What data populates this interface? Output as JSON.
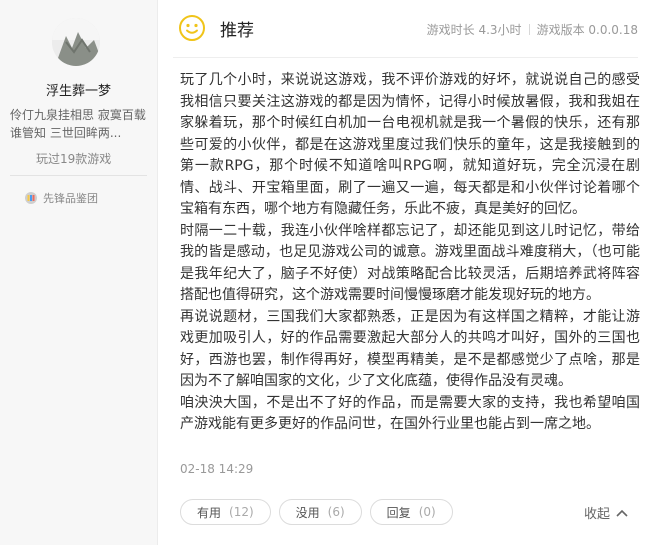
{
  "user": {
    "name": "浮生葬一梦",
    "bio": "伶仃九泉挂相思 寂寞百载谁管知 三世回眸两...",
    "played": "玩过19款游戏",
    "badge_label": "先锋品鉴团"
  },
  "review": {
    "verdict": "推荐",
    "playtime": "游戏时长 4.3小时",
    "version": "游戏版本 0.0.0.18",
    "paragraphs": [
      "玩了几个小时，来说说这游戏，我不评价游戏的好坏，就说说自己的感受我相信只要关注这游戏的都是因为情怀，记得小时候放暑假，我和我姐在家躲着玩，那个时候红白机加一台电视机就是我一个暑假的快乐，还有那些可爱的小伙伴，都是在这游戏里度过我们快乐的童年，这是我接触到的第一款RPG，那个时候不知道啥叫RPG啊，就知道好玩，完全沉浸在剧情、战斗、开宝箱里面，刷了一遍又一遍，每天都是和小伙伴讨论着哪个宝箱有东西，哪个地方有隐藏任务，乐此不疲，真是美好的回忆。",
      "时隔一二十载，我连小伙伴啥样都忘记了，却还能见到这儿时记忆，带给我的皆是感动，也足见游戏公司的诚意。游戏里面战斗难度稍大，（也可能是我年纪大了，脑子不好使）对战策略配合比较灵活，后期培养武将阵容搭配也值得研究，这个游戏需要时间慢慢琢磨才能发现好玩的地方。",
      "再说说题材，三国我们大家都熟悉，正是因为有这样国之精粹，才能让游戏更加吸引人，好的作品需要激起大部分人的共鸣才叫好，国外的三国也好，西游也罢，制作得再好，模型再精美，是不是都感觉少了点啥，那是因为不了解咱国家的文化，少了文化底蕴，使得作品没有灵魂。",
      "咱泱泱大国，不是出不了好的作品，而是需要大家的支持，我也希望咱国产游戏能有更多更好的作品问世，在国外行业里也能占到一席之地。"
    ],
    "date": "02-18 14:29"
  },
  "actions": {
    "useful_label": "有用",
    "useful_count": "(12)",
    "useless_label": "没用",
    "useless_count": "(6)",
    "reply_label": "回复",
    "reply_count": "(0)",
    "collapse_label": "收起"
  },
  "colors": {
    "accent_emoji": "#f0c419",
    "text": "#333333",
    "muted": "#999999"
  }
}
